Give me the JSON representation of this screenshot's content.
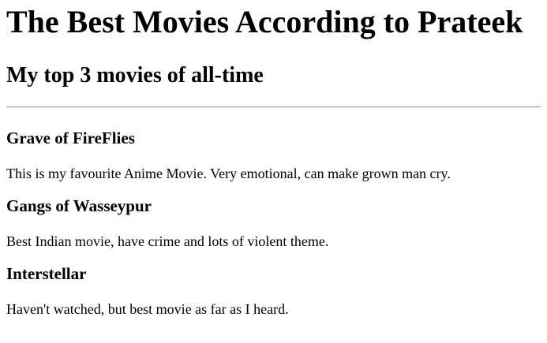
{
  "page": {
    "title": "The Best Movies According to Prateek",
    "subtitle": "My top 3 movies of all-time"
  },
  "movies": [
    {
      "name": "Grave of FireFlies",
      "description": "This is my favourite Anime Movie. Very emotional, can make grown man cry."
    },
    {
      "name": "Gangs of Wasseypur",
      "description": "Best Indian movie, have crime and lots of violent theme."
    },
    {
      "name": "Interstellar",
      "description": "Haven't watched, but best movie as far as I heard."
    }
  ]
}
